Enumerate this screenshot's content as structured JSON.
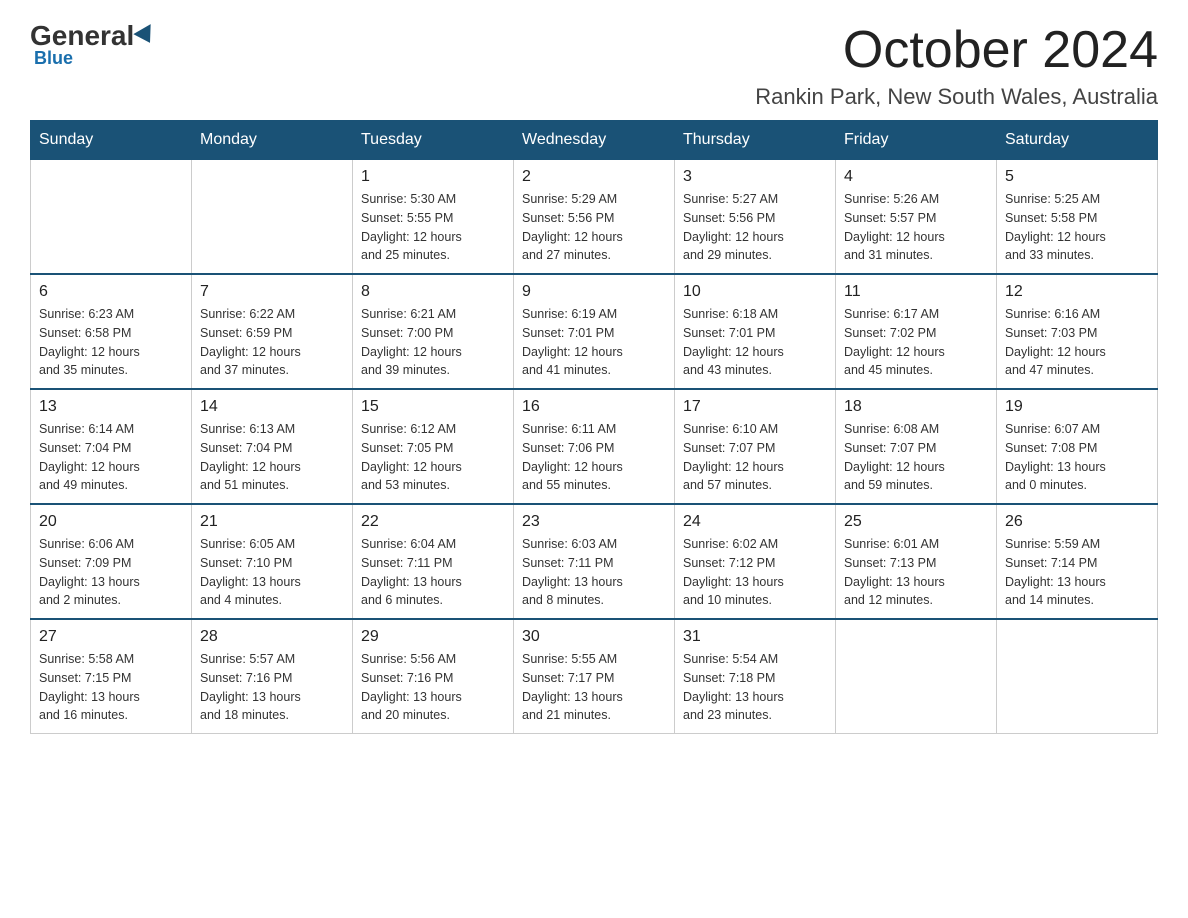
{
  "logo": {
    "general": "General",
    "blue": "Blue"
  },
  "title": "October 2024",
  "subtitle": "Rankin Park, New South Wales, Australia",
  "days_of_week": [
    "Sunday",
    "Monday",
    "Tuesday",
    "Wednesday",
    "Thursday",
    "Friday",
    "Saturday"
  ],
  "weeks": [
    [
      {
        "day": "",
        "info": ""
      },
      {
        "day": "",
        "info": ""
      },
      {
        "day": "1",
        "info": "Sunrise: 5:30 AM\nSunset: 5:55 PM\nDaylight: 12 hours\nand 25 minutes."
      },
      {
        "day": "2",
        "info": "Sunrise: 5:29 AM\nSunset: 5:56 PM\nDaylight: 12 hours\nand 27 minutes."
      },
      {
        "day": "3",
        "info": "Sunrise: 5:27 AM\nSunset: 5:56 PM\nDaylight: 12 hours\nand 29 minutes."
      },
      {
        "day": "4",
        "info": "Sunrise: 5:26 AM\nSunset: 5:57 PM\nDaylight: 12 hours\nand 31 minutes."
      },
      {
        "day": "5",
        "info": "Sunrise: 5:25 AM\nSunset: 5:58 PM\nDaylight: 12 hours\nand 33 minutes."
      }
    ],
    [
      {
        "day": "6",
        "info": "Sunrise: 6:23 AM\nSunset: 6:58 PM\nDaylight: 12 hours\nand 35 minutes."
      },
      {
        "day": "7",
        "info": "Sunrise: 6:22 AM\nSunset: 6:59 PM\nDaylight: 12 hours\nand 37 minutes."
      },
      {
        "day": "8",
        "info": "Sunrise: 6:21 AM\nSunset: 7:00 PM\nDaylight: 12 hours\nand 39 minutes."
      },
      {
        "day": "9",
        "info": "Sunrise: 6:19 AM\nSunset: 7:01 PM\nDaylight: 12 hours\nand 41 minutes."
      },
      {
        "day": "10",
        "info": "Sunrise: 6:18 AM\nSunset: 7:01 PM\nDaylight: 12 hours\nand 43 minutes."
      },
      {
        "day": "11",
        "info": "Sunrise: 6:17 AM\nSunset: 7:02 PM\nDaylight: 12 hours\nand 45 minutes."
      },
      {
        "day": "12",
        "info": "Sunrise: 6:16 AM\nSunset: 7:03 PM\nDaylight: 12 hours\nand 47 minutes."
      }
    ],
    [
      {
        "day": "13",
        "info": "Sunrise: 6:14 AM\nSunset: 7:04 PM\nDaylight: 12 hours\nand 49 minutes."
      },
      {
        "day": "14",
        "info": "Sunrise: 6:13 AM\nSunset: 7:04 PM\nDaylight: 12 hours\nand 51 minutes."
      },
      {
        "day": "15",
        "info": "Sunrise: 6:12 AM\nSunset: 7:05 PM\nDaylight: 12 hours\nand 53 minutes."
      },
      {
        "day": "16",
        "info": "Sunrise: 6:11 AM\nSunset: 7:06 PM\nDaylight: 12 hours\nand 55 minutes."
      },
      {
        "day": "17",
        "info": "Sunrise: 6:10 AM\nSunset: 7:07 PM\nDaylight: 12 hours\nand 57 minutes."
      },
      {
        "day": "18",
        "info": "Sunrise: 6:08 AM\nSunset: 7:07 PM\nDaylight: 12 hours\nand 59 minutes."
      },
      {
        "day": "19",
        "info": "Sunrise: 6:07 AM\nSunset: 7:08 PM\nDaylight: 13 hours\nand 0 minutes."
      }
    ],
    [
      {
        "day": "20",
        "info": "Sunrise: 6:06 AM\nSunset: 7:09 PM\nDaylight: 13 hours\nand 2 minutes."
      },
      {
        "day": "21",
        "info": "Sunrise: 6:05 AM\nSunset: 7:10 PM\nDaylight: 13 hours\nand 4 minutes."
      },
      {
        "day": "22",
        "info": "Sunrise: 6:04 AM\nSunset: 7:11 PM\nDaylight: 13 hours\nand 6 minutes."
      },
      {
        "day": "23",
        "info": "Sunrise: 6:03 AM\nSunset: 7:11 PM\nDaylight: 13 hours\nand 8 minutes."
      },
      {
        "day": "24",
        "info": "Sunrise: 6:02 AM\nSunset: 7:12 PM\nDaylight: 13 hours\nand 10 minutes."
      },
      {
        "day": "25",
        "info": "Sunrise: 6:01 AM\nSunset: 7:13 PM\nDaylight: 13 hours\nand 12 minutes."
      },
      {
        "day": "26",
        "info": "Sunrise: 5:59 AM\nSunset: 7:14 PM\nDaylight: 13 hours\nand 14 minutes."
      }
    ],
    [
      {
        "day": "27",
        "info": "Sunrise: 5:58 AM\nSunset: 7:15 PM\nDaylight: 13 hours\nand 16 minutes."
      },
      {
        "day": "28",
        "info": "Sunrise: 5:57 AM\nSunset: 7:16 PM\nDaylight: 13 hours\nand 18 minutes."
      },
      {
        "day": "29",
        "info": "Sunrise: 5:56 AM\nSunset: 7:16 PM\nDaylight: 13 hours\nand 20 minutes."
      },
      {
        "day": "30",
        "info": "Sunrise: 5:55 AM\nSunset: 7:17 PM\nDaylight: 13 hours\nand 21 minutes."
      },
      {
        "day": "31",
        "info": "Sunrise: 5:54 AM\nSunset: 7:18 PM\nDaylight: 13 hours\nand 23 minutes."
      },
      {
        "day": "",
        "info": ""
      },
      {
        "day": "",
        "info": ""
      }
    ]
  ]
}
